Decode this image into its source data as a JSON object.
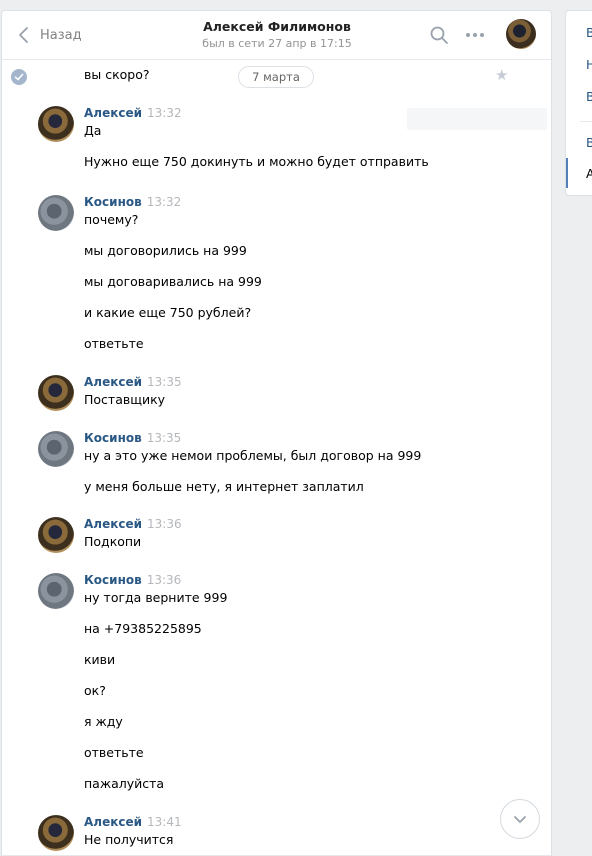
{
  "header": {
    "back_label": "Назад",
    "title": "Алексей Филимонов",
    "status": "был в сети 27 апр в 17:15"
  },
  "previous_message": "вы скоро?",
  "date_separator": "7 марта",
  "messages": [
    {
      "author": "Алексей",
      "time": "13:32",
      "lines": [
        "Да",
        "Нужно еще 750 докинуть и можно будет отправить"
      ]
    },
    {
      "author": "Косинов",
      "time": "13:32",
      "lines": [
        "почему?",
        "мы договорились на 999",
        "мы договаривались на 999",
        "и какие еще 750 рублей?",
        "ответьте"
      ]
    },
    {
      "author": "Алексей",
      "time": "13:35",
      "lines": [
        "Поставщику"
      ]
    },
    {
      "author": "Косинов",
      "time": "13:35",
      "lines": [
        "ну а это уже немои проблемы, был договор на 999",
        "у меня больше нету, я интернет заплатил"
      ]
    },
    {
      "author": "Алексей",
      "time": "13:36",
      "lines": [
        "Подкопи"
      ]
    },
    {
      "author": "Косинов",
      "time": "13:36",
      "lines": [
        "ну тогда верните 999",
        "на +79385225895",
        "киви",
        "ок?",
        "я жду",
        "ответьте",
        "пажалуйста"
      ]
    },
    {
      "author": "Алексей",
      "time": "13:41",
      "lines": [
        "Не получится"
      ]
    }
  ],
  "side_menu": {
    "items": [
      "В",
      "Н",
      "В",
      "В",
      "А"
    ]
  },
  "colors": {
    "author": "#2a5885",
    "background": "#edeef0",
    "accent": "#5181b8"
  }
}
